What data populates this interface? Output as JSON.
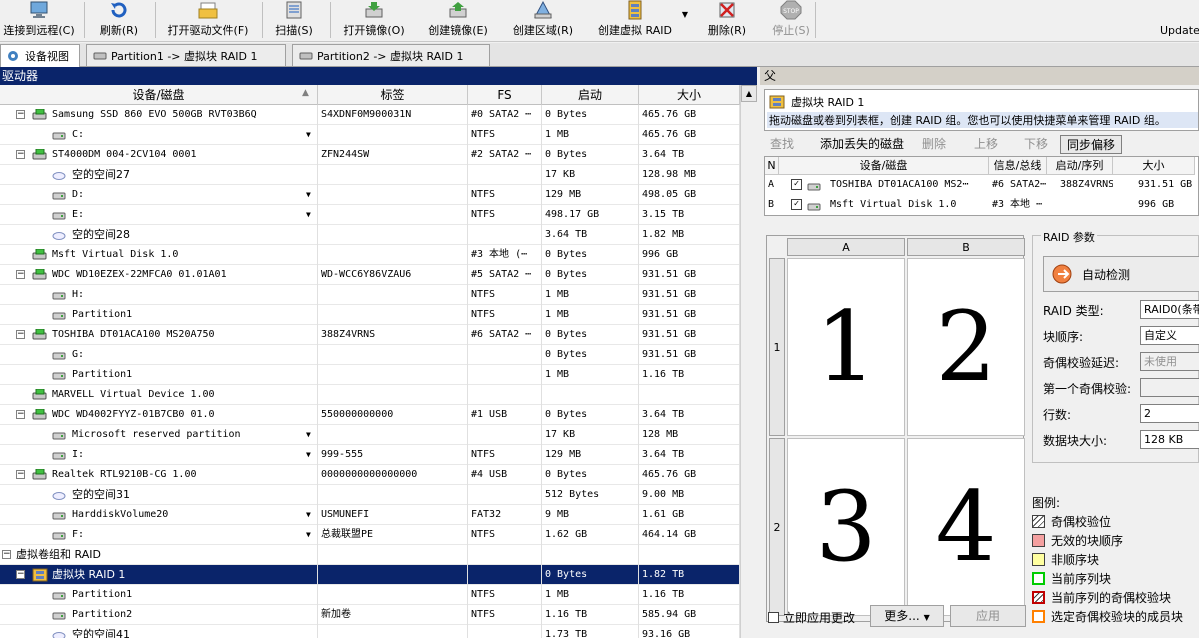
{
  "toolbar": {
    "items": [
      {
        "label": "连接到远程(C)",
        "icon": "remote-computer-icon",
        "disabled": false
      },
      {
        "label": "刷新(R)",
        "icon": "refresh-icon",
        "disabled": false
      },
      {
        "label": "打开驱动文件(F)",
        "icon": "open-drive-file-icon",
        "disabled": false
      },
      {
        "label": "扫描(S)",
        "icon": "scan-icon",
        "disabled": false
      },
      {
        "label": "打开镜像(O)",
        "icon": "open-image-icon",
        "disabled": false
      },
      {
        "label": "创建镜像(E)",
        "icon": "create-image-icon",
        "disabled": false
      },
      {
        "label": "创建区域(R)",
        "icon": "create-region-icon",
        "disabled": false
      },
      {
        "label": "创建虚拟 RAID",
        "icon": "create-virtual-raid-icon",
        "disabled": false
      },
      {
        "label": "删除(R)",
        "icon": "delete-icon",
        "disabled": false
      },
      {
        "label": "停止(S)",
        "icon": "stop-icon",
        "disabled": true
      }
    ],
    "update_label": "Update"
  },
  "tabs": [
    {
      "label": "设备视图",
      "active": true
    },
    {
      "label": "Partition1 -> 虚拟块 RAID 1",
      "active": false
    },
    {
      "label": "Partition2 -> 虚拟块 RAID 1",
      "active": false
    }
  ],
  "left": {
    "header": "驱动器",
    "columns": [
      "设备/磁盘",
      "标签",
      "FS",
      "启动",
      "大小"
    ],
    "rows": [
      {
        "level": 1,
        "expand": "-",
        "kind": "disk",
        "name": "Samsung SSD 860 EVO 500GB RVT03B6Q",
        "label": "S4XDNF0M900031N",
        "fs": "#0 SATA2 ⋯",
        "start": "0 Bytes",
        "size": "465.76 GB"
      },
      {
        "level": 2,
        "kind": "part",
        "dd": true,
        "name": "C:",
        "label": "",
        "fs": "NTFS",
        "start": "1 MB",
        "size": "465.76 GB"
      },
      {
        "level": 1,
        "expand": "-",
        "kind": "disk",
        "name": "ST4000DM 004-2CV104 0001",
        "label": "ZFN244SW",
        "fs": "#2 SATA2 ⋯",
        "start": "0 Bytes",
        "size": "3.64 TB"
      },
      {
        "level": 2,
        "kind": "free",
        "name": "空的空间27",
        "label": "",
        "fs": "",
        "start": "17 KB",
        "size": "128.98 MB"
      },
      {
        "level": 2,
        "kind": "part",
        "dd": true,
        "name": "D:",
        "label": "",
        "fs": "NTFS",
        "start": "129 MB",
        "size": "498.05 GB"
      },
      {
        "level": 2,
        "kind": "part",
        "dd": true,
        "name": "E:",
        "label": "",
        "fs": "NTFS",
        "start": "498.17 GB",
        "size": "3.15 TB"
      },
      {
        "level": 2,
        "kind": "free",
        "name": "空的空间28",
        "label": "",
        "fs": "",
        "start": "3.64 TB",
        "size": "1.82 MB"
      },
      {
        "level": 1,
        "kind": "disk",
        "name": "Msft Virtual Disk 1.0",
        "label": "",
        "fs": "#3 本地 (⋯",
        "start": "0 Bytes",
        "size": "996 GB"
      },
      {
        "level": 1,
        "expand": "-",
        "kind": "disk",
        "name": "WDC WD10EZEX-22MFCA0 01.01A01",
        "label": "WD-WCC6Y86VZAU6",
        "fs": "#5 SATA2 ⋯",
        "start": "0 Bytes",
        "size": "931.51 GB"
      },
      {
        "level": 2,
        "kind": "part",
        "name": "H:",
        "label": "",
        "fs": "NTFS",
        "start": "1 MB",
        "size": "931.51 GB"
      },
      {
        "level": 2,
        "kind": "part",
        "name": "Partition1",
        "label": "",
        "fs": "NTFS",
        "start": "1 MB",
        "size": "931.51 GB"
      },
      {
        "level": 1,
        "expand": "-",
        "kind": "disk",
        "name": "TOSHIBA DT01ACA100 MS20A750",
        "label": "388Z4VRNS",
        "fs": "#6 SATA2 ⋯",
        "start": "0 Bytes",
        "size": "931.51 GB"
      },
      {
        "level": 2,
        "kind": "part",
        "name": "G:",
        "label": "",
        "fs": "",
        "start": "0 Bytes",
        "size": "931.51 GB"
      },
      {
        "level": 2,
        "kind": "part",
        "name": "Partition1",
        "label": "",
        "fs": "",
        "start": "1 MB",
        "size": "1.16 TB"
      },
      {
        "level": 1,
        "kind": "disk",
        "name": "MARVELL Virtual Device 1.00",
        "label": "",
        "fs": "",
        "start": "",
        "size": ""
      },
      {
        "level": 1,
        "expand": "-",
        "kind": "disk",
        "name": "WDC WD4002FYYZ-01B7CB0 01.0",
        "label": "550000000000",
        "fs": "#1 USB",
        "start": "0 Bytes",
        "size": "3.64 TB"
      },
      {
        "level": 2,
        "kind": "part",
        "dd": true,
        "name": "Microsoft reserved partition",
        "label": "",
        "fs": "",
        "start": "17 KB",
        "size": "128 MB"
      },
      {
        "level": 2,
        "kind": "part",
        "dd": true,
        "name": "I:",
        "label": "999-555",
        "fs": "NTFS",
        "start": "129 MB",
        "size": "3.64 TB"
      },
      {
        "level": 1,
        "expand": "-",
        "kind": "disk",
        "name": "Realtek RTL9210B-CG 1.00",
        "label": "0000000000000000",
        "fs": "#4 USB",
        "start": "0 Bytes",
        "size": "465.76 GB"
      },
      {
        "level": 2,
        "kind": "free",
        "name": "空的空间31",
        "label": "",
        "fs": "",
        "start": "512 Bytes",
        "size": "9.00 MB"
      },
      {
        "level": 2,
        "kind": "part",
        "dd": true,
        "name": "HarddiskVolume20",
        "label": "USMUNEFI",
        "fs": "FAT32",
        "start": "9 MB",
        "size": "1.61 GB"
      },
      {
        "level": 2,
        "kind": "part",
        "dd": true,
        "name": "F:",
        "label": "总裁联盟PE",
        "fs": "NTFS",
        "start": "1.62 GB",
        "size": "464.14 GB"
      },
      {
        "level": 0,
        "expand": "-",
        "kind": "group",
        "name": "虚拟卷组和 RAID",
        "label": "",
        "fs": "",
        "start": "",
        "size": ""
      },
      {
        "level": 1,
        "expand": "-",
        "kind": "raid",
        "selected": true,
        "name": "虚拟块 RAID 1",
        "label": "",
        "fs": "",
        "start": "0 Bytes",
        "size": "1.82 TB"
      },
      {
        "level": 2,
        "kind": "part",
        "name": "Partition1",
        "label": "",
        "fs": "NTFS",
        "start": "1 MB",
        "size": "1.16 TB"
      },
      {
        "level": 2,
        "kind": "part",
        "name": "Partition2",
        "label": "新加卷",
        "fs": "NTFS",
        "start": "1.16 TB",
        "size": "585.94 GB"
      },
      {
        "level": 2,
        "kind": "free",
        "name": "空的空间41",
        "label": "",
        "fs": "",
        "start": "1.73 TB",
        "size": "93.16 GB"
      }
    ]
  },
  "right": {
    "title": "父",
    "info_title": "虚拟块 RAID 1",
    "info_text": "拖动磁盘或卷到列表框，创建 RAID 组。您也可以使用快捷菜单来管理 RAID 组。",
    "buttons": [
      {
        "label": "查找",
        "disabled": true
      },
      {
        "label": "添加丢失的磁盘",
        "disabled": false
      },
      {
        "label": "删除",
        "disabled": true
      },
      {
        "label": "上移",
        "disabled": true
      },
      {
        "label": "下移",
        "disabled": true
      },
      {
        "label": "同步偏移",
        "disabled": false
      }
    ],
    "member_columns": [
      "N",
      "设备/磁盘",
      "信息/总线",
      "启动/序列",
      "大小"
    ],
    "members": [
      {
        "n": "A",
        "checked": true,
        "name": "TOSHIBA DT01ACA100 MS2⋯",
        "info": "#6 SATA2⋯",
        "start": "388Z4VRNS",
        "size": "931.51 GB"
      },
      {
        "n": "B",
        "checked": true,
        "name": "Msft Virtual Disk 1.0",
        "info": "#3 本地 ⋯",
        "start": "",
        "size": "996 GB"
      }
    ],
    "grid": {
      "cols": [
        "A",
        "B"
      ],
      "rows": [
        "1",
        "2"
      ],
      "cells": [
        "1",
        "2",
        "3",
        "4"
      ]
    },
    "params": {
      "legend": "RAID 参数",
      "auto_detect": "自动检测",
      "fields": [
        {
          "label": "RAID 类型:",
          "value": "RAID0(条带",
          "disabled": false
        },
        {
          "label": "块顺序:",
          "value": "自定义",
          "disabled": false
        },
        {
          "label": "奇偶校验延迟:",
          "value": "未使用",
          "disabled": true
        },
        {
          "label": "第一个奇偶校验:",
          "value": "",
          "disabled": true
        },
        {
          "label": "行数:",
          "value": "2",
          "disabled": false
        },
        {
          "label": "数据块大小:",
          "value": "128 KB",
          "disabled": false
        }
      ]
    },
    "legend": {
      "title": "图例:",
      "items": [
        {
          "label": "奇偶校验位",
          "color": "#ffffff",
          "hatch": true
        },
        {
          "label": "无效的块顺序",
          "color": "#f4a0a0"
        },
        {
          "label": "非顺序块",
          "color": "#ffffa0"
        },
        {
          "label": "当前序列块",
          "color": "#ffffff",
          "border": "#00cc00"
        },
        {
          "label": "当前序列的奇偶校验块",
          "color": "#ffffff",
          "border": "#c00000",
          "hatch": true
        },
        {
          "label": "选定奇偶校验块的成员块",
          "color": "#ffffff",
          "border": "#ff8000"
        }
      ]
    },
    "apply_immediately": "立即应用更改",
    "more_button": "更多...",
    "apply_button": "应用"
  }
}
